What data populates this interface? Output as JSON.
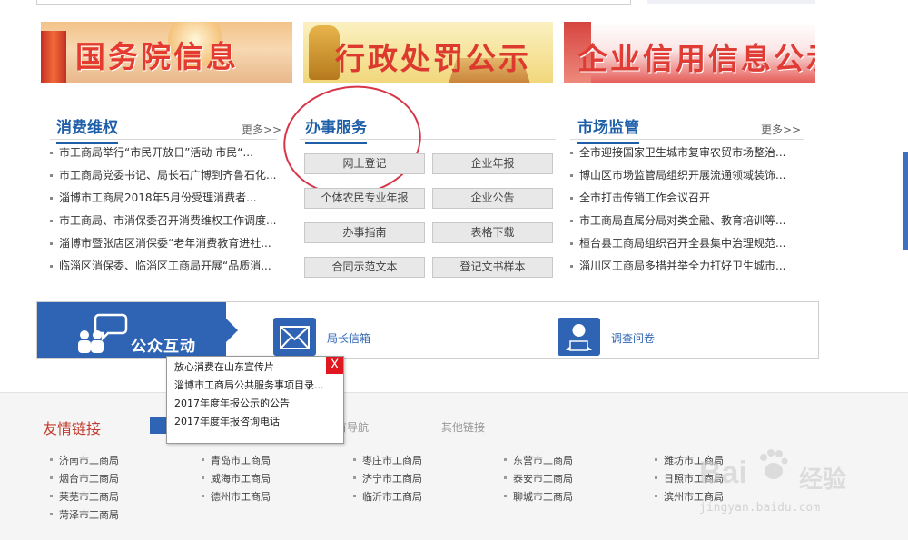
{
  "banners": [
    {
      "text": "国务院信息"
    },
    {
      "text": "行政处罚公示"
    },
    {
      "text": "企业信用信息公示"
    }
  ],
  "consumer": {
    "title": "消费维权",
    "more": "更多>>",
    "items": [
      "市工商局举行“市民开放日”活动 市民“...",
      "市工商局党委书记、局长石广博到齐鲁石化...",
      "淄博市工商局2018年5月份受理消费者...",
      "市工商局、市消保委召开消费维权工作调度...",
      "淄博市暨张店区消保委“老年消费教育进社...",
      "临淄区消保委、临淄区工商局开展“品质消..."
    ]
  },
  "service": {
    "title": "办事服务",
    "buttons": [
      "网上登记",
      "企业年报",
      "个体农民专业年报",
      "企业公告",
      "办事指南",
      "表格下载",
      "合同示范文本",
      "登记文书样本"
    ]
  },
  "market": {
    "title": "市场监管",
    "more": "更多>>",
    "items": [
      "全市迎接国家卫生城市复审农贸市场整治...",
      "博山区市场监管局组织开展流通领域装饰...",
      "全市打击传销工作会议召开",
      "市工商局直属分局对类金融、教育培训等...",
      "桓台县工商局组织召开全县集中治理规范...",
      "淄川区工商局多措并举全力打好卫生城市..."
    ]
  },
  "interaction": {
    "title": "公众互动",
    "mailbox": "局长信箱",
    "survey": "调查问卷"
  },
  "popup": {
    "close": "X",
    "items": [
      "放心消费在山东宣传片",
      "淄博市工商局公共服务事项目录...",
      "2017年度年报公示的公告",
      "2017年度年报咨询电话"
    ]
  },
  "footer": {
    "title": "友情链接",
    "tabs": [
      "首导航",
      "其他链接"
    ],
    "links": [
      "济南市工商局",
      "青岛市工商局",
      "枣庄市工商局",
      "东营市工商局",
      "潍坊市工商局",
      "烟台市工商局",
      "威海市工商局",
      "济宁市工商局",
      "泰安市工商局",
      "日照市工商局",
      "莱芜市工商局",
      "德州市工商局",
      "临沂市工商局",
      "聊城市工商局",
      "滨州市工商局",
      "菏泽市工商局"
    ]
  },
  "watermark": {
    "logo": "Bai",
    "brand": "经验",
    "url": "jingyan.baidu.com"
  },
  "colors": {
    "brand_blue": "#2f64b5",
    "title_blue": "#1f5fa8",
    "accent_red": "#e0171f"
  }
}
